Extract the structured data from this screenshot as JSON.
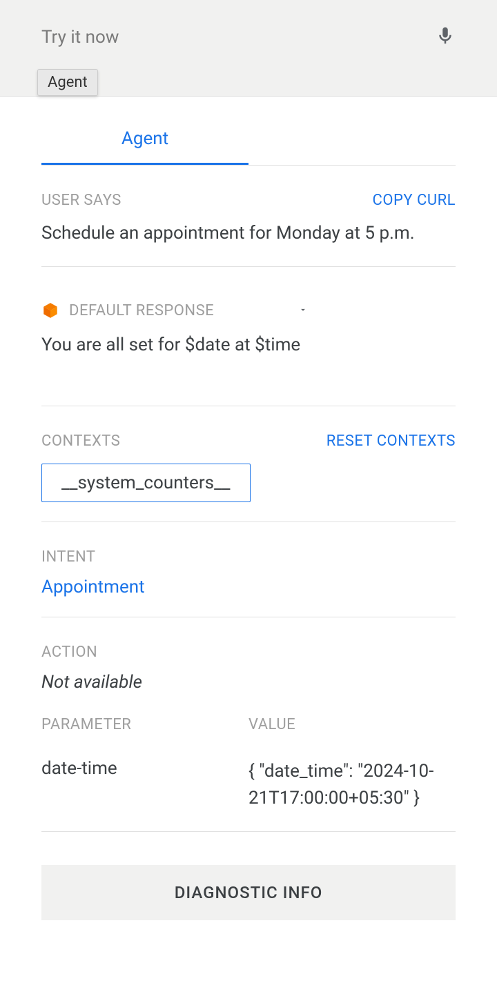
{
  "header": {
    "placeholder": "Try it now",
    "agent_chip": "Agent"
  },
  "tabs": {
    "agent": "Agent"
  },
  "user_says": {
    "label": "USER SAYS",
    "copy_curl": "COPY CURL",
    "text": "Schedule an appointment for Monday at 5 p.m."
  },
  "response": {
    "label": "DEFAULT RESPONSE",
    "text": "You are all set for $date at $time"
  },
  "contexts": {
    "label": "CONTEXTS",
    "reset": "RESET CONTEXTS",
    "chip": "__system_counters__"
  },
  "intent": {
    "label": "INTENT",
    "value": "Appointment"
  },
  "action": {
    "label": "ACTION",
    "value": "Not available"
  },
  "parameters": {
    "param_header": "PARAMETER",
    "value_header": "VALUE",
    "name": "date-time",
    "value": "{ \"date_time\": \"2024-10-21T17:00:00+05:30\" }"
  },
  "diagnostic": {
    "label": "DIAGNOSTIC INFO"
  }
}
